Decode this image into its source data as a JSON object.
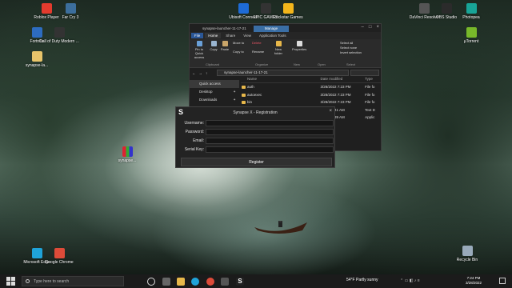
{
  "desktop": {
    "left_icons": [
      {
        "label": "Roblox Player",
        "icon": "roblox-icon",
        "color": "#e33b2e"
      },
      {
        "label": "Far Cry 3",
        "icon": "farcry-icon",
        "color": "#3c6e9c"
      },
      {
        "label": "Fortnite",
        "icon": "fortnite-icon",
        "color": "#2d6cc0"
      },
      {
        "label": "Call of Duty Modern ...",
        "icon": "cod-icon",
        "color": "#333333"
      },
      {
        "label": "synapse-la...",
        "icon": "zip-folder-icon",
        "color": "#e8c46a"
      }
    ],
    "top_icons": [
      {
        "label": "Ubisoft Connect",
        "icon": "ubisoft-icon",
        "color": "#1e6bd6"
      },
      {
        "label": "EPIC GAMES",
        "icon": "epic-icon",
        "color": "#333333"
      },
      {
        "label": "Rockstar Games",
        "icon": "rockstar-icon",
        "color": "#f3b51b"
      }
    ],
    "right_icons": [
      {
        "label": "DaVinci Resolve",
        "icon": "davinci-icon",
        "color": "#555555"
      },
      {
        "label": "OBS Studio",
        "icon": "obs-icon",
        "color": "#2b2b2b"
      },
      {
        "label": "Photopea",
        "icon": "photopea-icon",
        "color": "#18a497"
      },
      {
        "label": "µTorrent",
        "icon": "utorrent-icon",
        "color": "#78b82a"
      }
    ],
    "bottom_icons": [
      {
        "label": "Microsoft Edge",
        "icon": "edge-icon",
        "color": "#1fa3d9"
      },
      {
        "label": "Google Chrome",
        "icon": "chrome-icon",
        "color": "#dd4b39"
      }
    ],
    "recycle_bin": "Recycle Bin",
    "winrar_label": "synapse..."
  },
  "explorer": {
    "title": "synapse-launcher-11-17-21",
    "manage_tab": "Manage",
    "tabs": [
      "File",
      "Home",
      "Share",
      "View",
      "Application Tools"
    ],
    "ribbon": {
      "pin": "Pin to Quick access",
      "copy": "Copy",
      "paste": "Paste",
      "move_to": "Move to",
      "copy_to": "Copy to",
      "delete": "Delete",
      "rename": "Rename",
      "new_folder": "New folder",
      "properties": "Properties",
      "select_all": "Select all",
      "select_none": "Select none",
      "invert_selection": "Invert selection",
      "groups": [
        "Clipboard",
        "Organize",
        "New",
        "Open",
        "Select"
      ]
    },
    "address": "synapse-launcher-11-17-21",
    "nav": [
      {
        "label": "Quick access",
        "pinned": false
      },
      {
        "label": "Desktop",
        "pinned": true
      },
      {
        "label": "Downloads",
        "pinned": true
      }
    ],
    "columns": [
      "Name",
      "Date modified",
      "Type"
    ],
    "rows": [
      {
        "name": "auth",
        "date": "3/28/2022 7:23 PM",
        "type": "File fo"
      },
      {
        "name": "autoexec",
        "date": "3/28/2022 7:23 PM",
        "type": "File fo"
      },
      {
        "name": "bin",
        "date": "3/28/2022 7:23 PM",
        "type": "File fo"
      },
      {
        "name": "",
        "date": "2021 10:41 AM",
        "type": "Text D"
      },
      {
        "name": "",
        "date": "2021 10:39 AM",
        "type": "Applic"
      }
    ]
  },
  "registration": {
    "title": "Synapse X - Registration",
    "logo": "S",
    "close": "×",
    "fields": [
      {
        "label": "Username:"
      },
      {
        "label": "Password:"
      },
      {
        "label": "Email:"
      },
      {
        "label": "Serial Key:"
      }
    ],
    "button": "Register"
  },
  "taskbar": {
    "search_placeholder": "Type here to search",
    "weather": "54°F  Partly sunny",
    "time": "7:24 PM",
    "date": "3/28/2022"
  }
}
